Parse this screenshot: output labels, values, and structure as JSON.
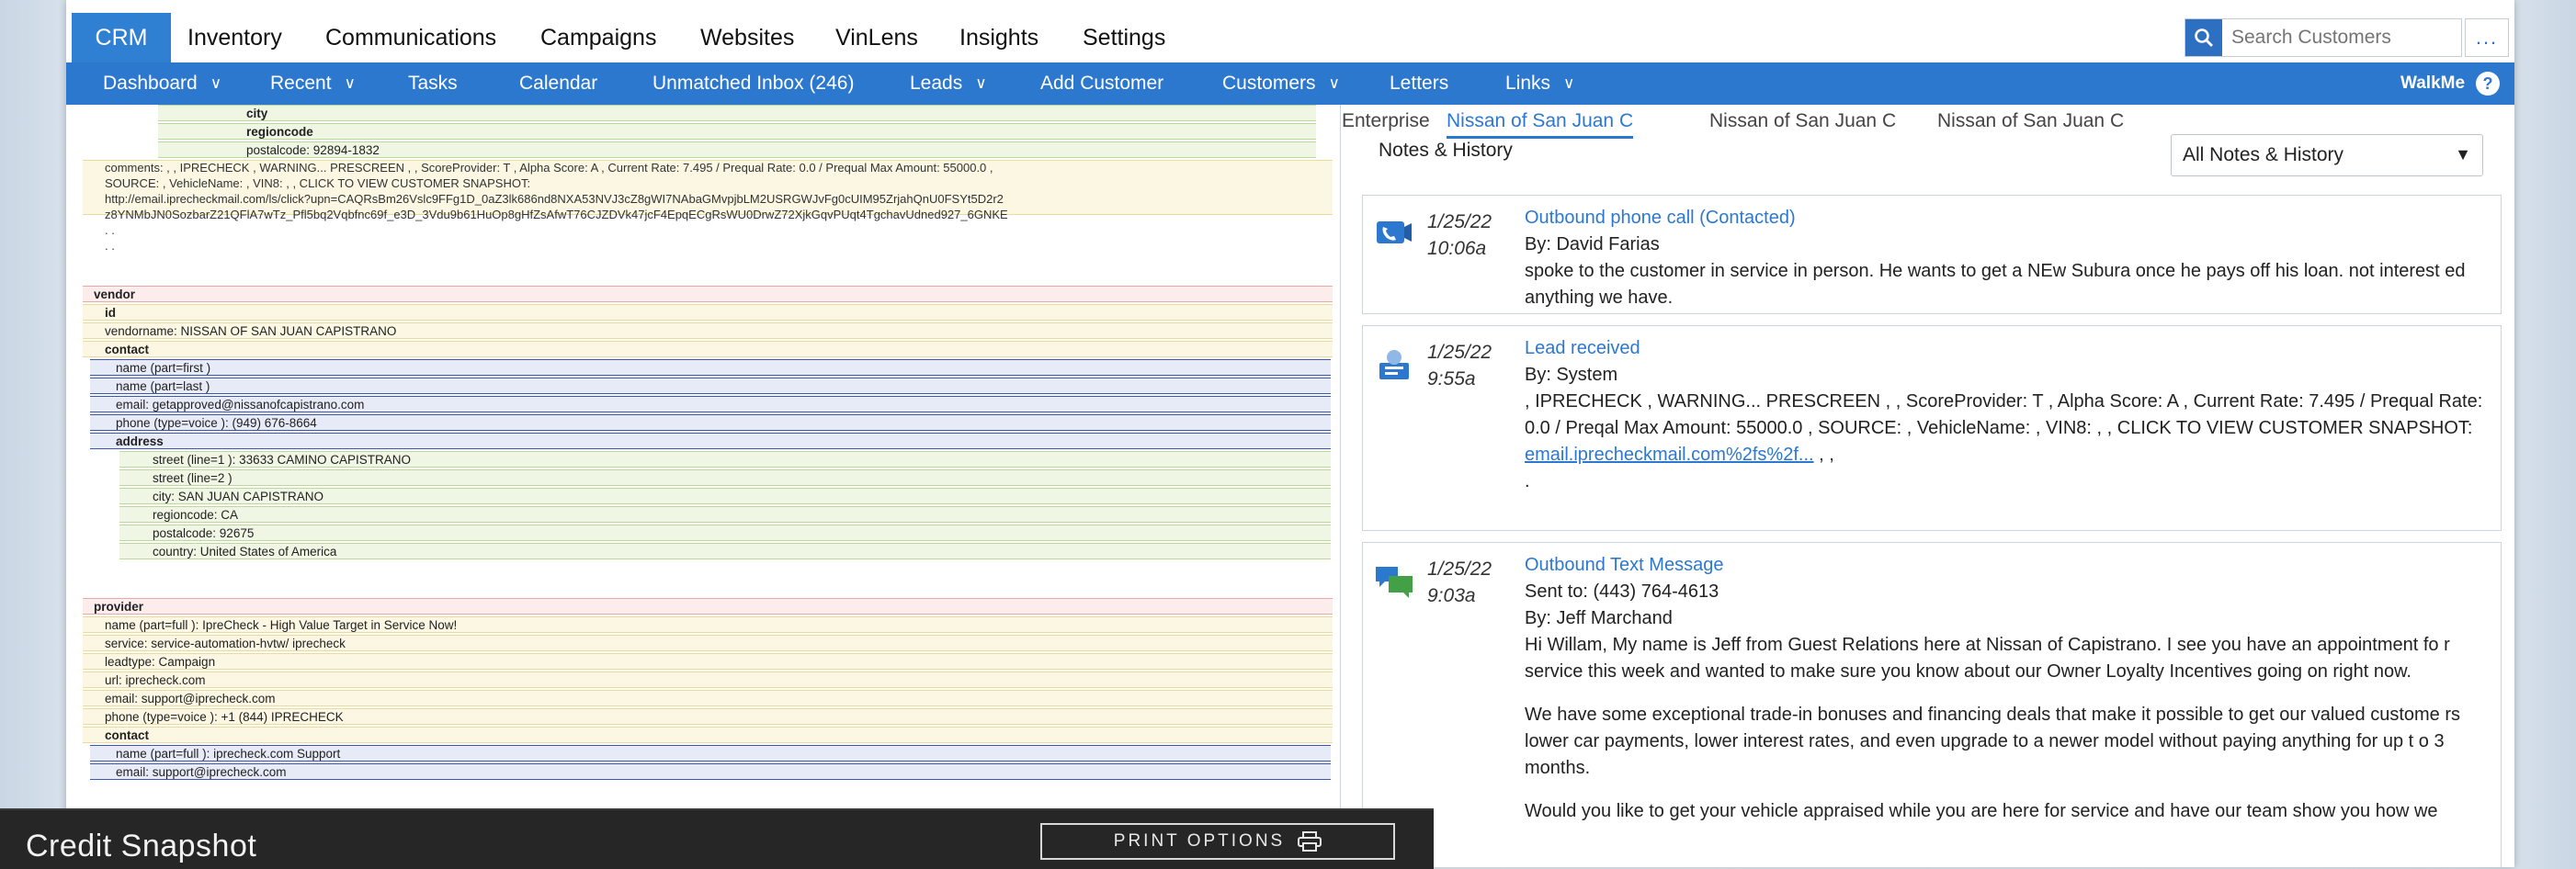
{
  "topnav": {
    "crm": "CRM",
    "items": [
      "Inventory",
      "Communications",
      "Campaigns",
      "Websites",
      "VinLens",
      "Insights",
      "Settings"
    ],
    "search_placeholder": "Search Customers",
    "more": "..."
  },
  "subnav": {
    "items": [
      "Dashboard",
      "Recent",
      "Tasks",
      "Calendar",
      "Unmatched Inbox (246)",
      "Leads",
      "Add Customer",
      "Customers",
      "Letters",
      "Links"
    ],
    "walkme": "WalkMe",
    "help": "?"
  },
  "xml": {
    "rows_top": [
      "city",
      "regioncode",
      "postalcode: 92894-1832"
    ],
    "comments": [
      "comments: , , IPRECHECK , WARNING... PRESCREEN , , ScoreProvider: T , Alpha Score: A , Current Rate: 7.495 / Prequal Rate: 0.0 / Prequal Max Amount: 55000.0 ,",
      "SOURCE: , VehicleName: , VIN8: , , CLICK TO VIEW CUSTOMER SNAPSHOT:",
      "http://email.iprecheckmail.com/ls/click?upn=CAQRsBm26Vslc9FFg1D_0aZ3lk686nd8NXA53NVJ3cZ8gWI7NAbaGMvpjbLM2USRGWJvFg0cUIM95ZrjahQnU0FSYt5D2r2",
      "z8YNMbJN0SozbarZ21QFlA7wTz_Pfl5bq2Vqbfnc69f_e3D_3Vdu9b61HuOp8gHfZsAfwT76CJZDVk47jcF4EpqECgRsWU0DrwZ72XjkGqvPUqt4TgchavUdned927_6GNKE",
      ". .",
      ". ."
    ],
    "vendor": {
      "label": "vendor",
      "id": "id",
      "vendorname": "vendorname: NISSAN OF SAN JUAN CAPISTRANO",
      "contact": "contact",
      "name_first": "name (part=first )",
      "name_last": "name (part=last )",
      "email": "email: getapproved@nissanofcapistrano.com",
      "phone": "phone (type=voice ): (949) 676-8664",
      "address": "address",
      "street1": "street (line=1 ): 33633 CAMINO CAPISTRANO",
      "street2": "street (line=2 )",
      "city": "city: SAN JUAN CAPISTRANO",
      "regioncode": "regioncode: CA",
      "postalcode": "postalcode: 92675",
      "country": "country: United States of America"
    },
    "provider": {
      "label": "provider",
      "name": "name (part=full ): IpreCheck - High Value Target in Service Now!",
      "service": "service: service-automation-hvtw/ iprecheck",
      "leadtype": "leadtype: Campaign",
      "url": "url: iprecheck.com",
      "email": "email: support@iprecheck.com",
      "phone": "phone (type=voice ): +1 (844) IPRECHECK",
      "contact": "contact",
      "contact_name": "name (part=full ): iprecheck.com Support",
      "contact_email": "email: support@iprecheck.com"
    }
  },
  "snapshot": {
    "title": "Credit Snapshot",
    "print": "PRINT OPTIONS"
  },
  "right": {
    "tabs": [
      "Enterprise",
      "Nissan of San Juan C",
      "Nissan of San Juan C",
      "Nissan of San Juan C"
    ],
    "notes_header": "Notes & History",
    "filter_value": "All Notes & History",
    "notes": [
      {
        "date": "1/25/22",
        "time": "10:06a",
        "title": "Outbound phone call (Contacted)",
        "by": "By: David Farias",
        "text": "spoke to the customer in service in person. He wants to get a NEw Subura once he pays off his loan. not interest ed anything we have."
      },
      {
        "date": "1/25/22",
        "time": "9:55a",
        "title": "Lead received",
        "by": "By: System",
        "text": ", IPRECHECK , WARNING... PRESCREEN , , ScoreProvider: T , Alpha Score: A , Current Rate: 7.495 / Prequal Rate: 0.0 / Preqal Max Amount: 55000.0 , SOURCE: , VehicleName: , VIN8: , , CLICK TO VIEW CUSTOMER SNAPSHOT:",
        "link": "email.iprecheckmail.com%2fs%2f...",
        "after": ", ,",
        "dot": "."
      },
      {
        "date": "1/25/22",
        "time": "9:03a",
        "title": "Outbound Text Message",
        "sent": "Sent to: (443) 764-4613",
        "by": "By: Jeff Marchand",
        "p1": "Hi Willam, My name is Jeff from Guest Relations here at Nissan of Capistrano. I see you have an appointment fo r service this week and wanted to make sure you know about our Owner Loyalty Incentives going on right now.",
        "p2": "We have some exceptional trade-in bonuses and financing deals that make it possible to get our valued custome rs lower car payments, lower interest rates, and even upgrade to a newer model without paying anything for up t o 3 months.",
        "p3": "Would you like to get your vehicle appraised while you are here for service and have our team show you how we"
      }
    ]
  }
}
